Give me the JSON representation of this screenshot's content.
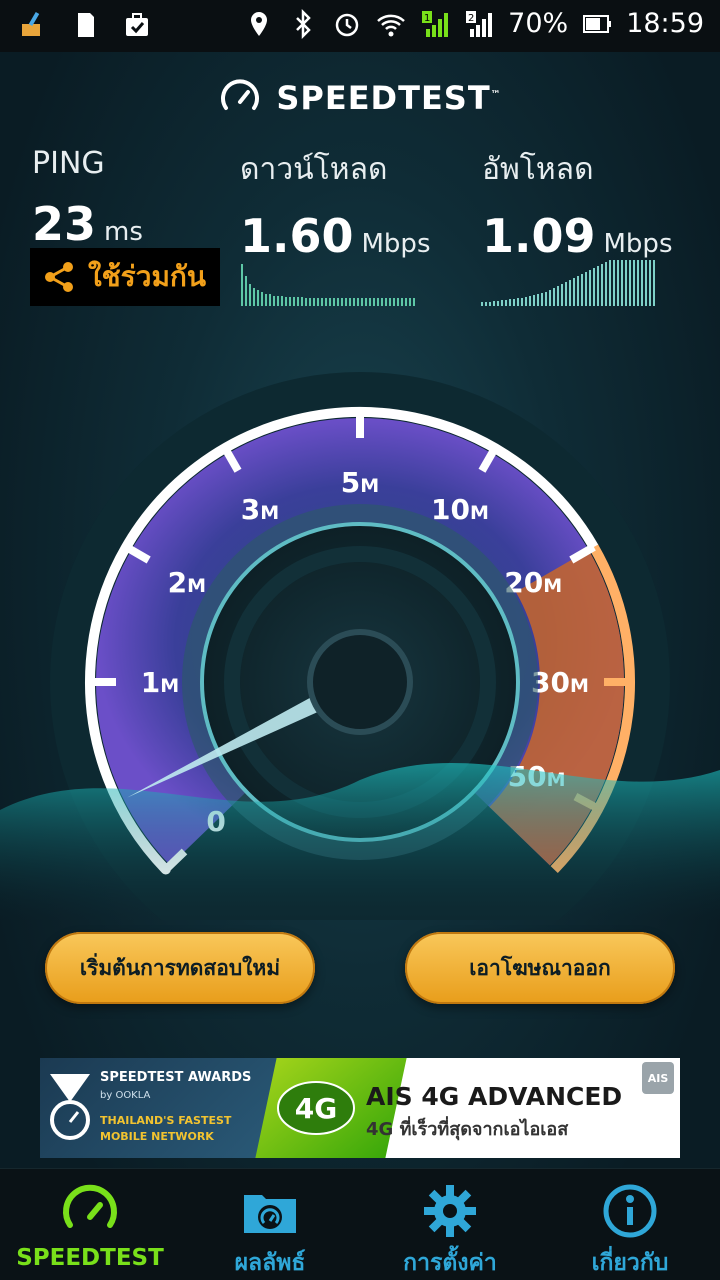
{
  "status_bar": {
    "battery": "70%",
    "time": "18:59",
    "sim1": "1",
    "sim2": "2"
  },
  "app": {
    "title": "SPEEDTEST",
    "tm": "™"
  },
  "metrics": {
    "ping": {
      "label": "PING",
      "value": "23",
      "unit": "ms"
    },
    "download": {
      "label": "ดาวน์โหลด",
      "value": "1.60",
      "unit": "Mbps"
    },
    "upload": {
      "label": "อัพโหลด",
      "value": "1.09",
      "unit": "Mbps"
    }
  },
  "share": {
    "label": "ใช้ร่วมกัน"
  },
  "gauge": {
    "labels": [
      {
        "num": "0",
        "unit": ""
      },
      {
        "num": "1",
        "unit": "M"
      },
      {
        "num": "2",
        "unit": "M"
      },
      {
        "num": "3",
        "unit": "M"
      },
      {
        "num": "5",
        "unit": "M"
      },
      {
        "num": "10",
        "unit": "M"
      },
      {
        "num": "20",
        "unit": "M"
      },
      {
        "num": "30",
        "unit": "M"
      },
      {
        "num": "50",
        "unit": "M"
      }
    ],
    "needle_value_mbps": 0.4
  },
  "buttons": {
    "restart": "เริ่มต้นการทดสอบใหม่",
    "remove_ads": "เอาโฆษณาออก"
  },
  "ad": {
    "award_title": "SPEEDTEST AWARDS",
    "award_by": "by OOKLA",
    "award_sub1": "THAILAND'S FASTEST",
    "award_sub2": "MOBILE NETWORK",
    "badge": "4G",
    "headline": "AIS 4G ADVANCED",
    "subline": "4G ที่เร็วที่สุดจากเอไอเอส",
    "corner": "AIS"
  },
  "nav": {
    "items": [
      {
        "label": "SPEEDTEST",
        "icon": "speedometer-icon"
      },
      {
        "label": "ผลลัพธ์",
        "icon": "results-folder-icon"
      },
      {
        "label": "การตั้งค่า",
        "icon": "gear-icon"
      },
      {
        "label": "เกี่ยวกับ",
        "icon": "info-icon"
      }
    ]
  },
  "colors": {
    "accent_green": "#79e01a",
    "accent_blue": "#2fa7d8",
    "button_gold": "#f2a71e",
    "gauge_purple": "#7d5fd6",
    "gauge_orange": "#e8792a"
  }
}
